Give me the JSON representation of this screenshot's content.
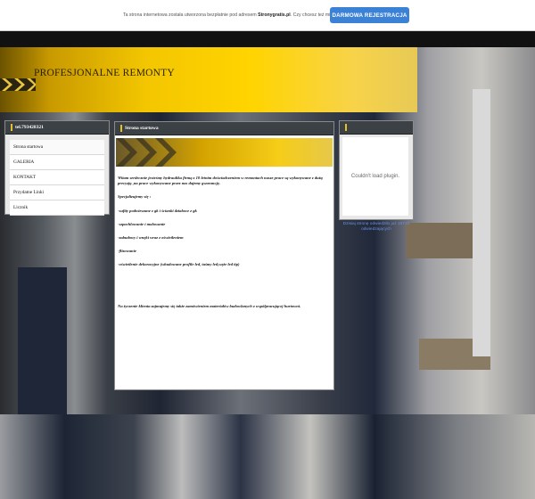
{
  "topbar": {
    "notice_prefix": "Ta strona internetowa została utworzona bezpłatnie pod adresem ",
    "notice_link": "Stronygratis.pl",
    "notice_suffix": ". Czy chcesz też mieć własną stronę?",
    "register_button": "DARMOWA REJESTRACJA"
  },
  "header": {
    "title": "PROFESJONALNE REMONTY"
  },
  "left_panel": {
    "title": "tel.793428321",
    "menu": [
      "Strona startowa",
      "GALERIA",
      "KONTAKT",
      "Przydatne Linki",
      "Licznik"
    ]
  },
  "center_panel": {
    "title": "Strona startowa",
    "intro": "Witam serdecznie jesteśmy hydraulika firmą z 10 letnim doświadczeniem w remontach nasze prace są wykonywane z dużą precyzją ,na prace wykonywane przez nas dajemy gwarancję.",
    "spec_title": "Specjalizujemy się :",
    "spec_items": [
      "-sufity podwieszane z gk i ścianki działowe z gk",
      "-szpachlowanie i malowanie",
      "-zabudowy i wnęki wraz z oświetleniem",
      "-flizowanie",
      "-oświetlenie dekoracyjne (wbudowane profile led, taśmy led,węże led itp)"
    ],
    "outro": "Na życzenie klienta zajmujemy się także zamówieniem materiałów budowlanych z współpracującej hurtowni."
  },
  "right_panel": {
    "title": "",
    "plugin_message": "Couldn't load plugin."
  },
  "counter_text": "Dzisiaj stronę odwiedziło już 18733 odwiedzających",
  "colors": {
    "accent_yellow": "#f3c600",
    "register_blue": "#3b82d6",
    "panel_head": "#3c4146"
  }
}
